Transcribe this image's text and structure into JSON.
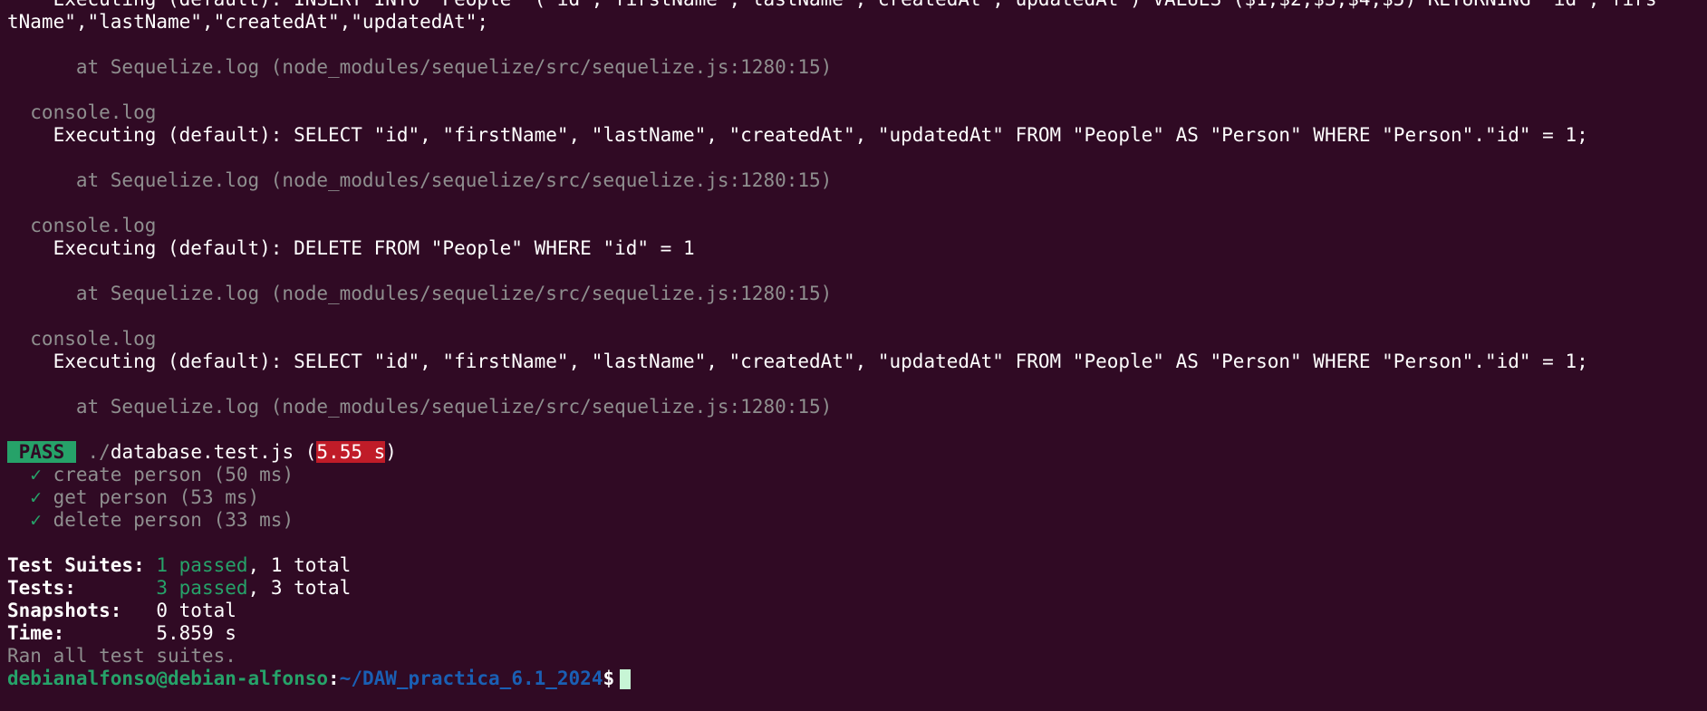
{
  "terminal": {
    "insert_line_1": "    Executing (default): INSERT INTO \"People\" (\"id\",\"firstName\",\"lastName\",\"createdAt\",\"updatedAt\") VALUES ($1,$2,$3,$4,$5) RETURNING \"id\",\"firs",
    "insert_line_2": "tName\",\"lastName\",\"createdAt\",\"updatedAt\";",
    "trace_1": "      at Sequelize.log (node_modules/sequelize/src/sequelize.js:1280:15)",
    "console_label_1": "  console.log",
    "select_line_1": "    Executing (default): SELECT \"id\", \"firstName\", \"lastName\", \"createdAt\", \"updatedAt\" FROM \"People\" AS \"Person\" WHERE \"Person\".\"id\" = 1;",
    "trace_2": "      at Sequelize.log (node_modules/sequelize/src/sequelize.js:1280:15)",
    "console_label_2": "  console.log",
    "delete_line": "    Executing (default): DELETE FROM \"People\" WHERE \"id\" = 1",
    "trace_3": "      at Sequelize.log (node_modules/sequelize/src/sequelize.js:1280:15)",
    "console_label_3": "  console.log",
    "select_line_2": "    Executing (default): SELECT \"id\", \"firstName\", \"lastName\", \"createdAt\", \"updatedAt\" FROM \"People\" AS \"Person\" WHERE \"Person\".\"id\" = 1;",
    "trace_4": "      at Sequelize.log (node_modules/sequelize/src/sequelize.js:1280:15)"
  },
  "result": {
    "pass_badge": " PASS ",
    "path_prefix": "./",
    "file_name": "database.test.js",
    "duration": "5.55 s",
    "tests": [
      {
        "check": "  ✓ ",
        "name": "create person (50 ms)"
      },
      {
        "check": "  ✓ ",
        "name": "get person (53 ms)"
      },
      {
        "check": "  ✓ ",
        "name": "delete person (33 ms)"
      }
    ]
  },
  "summary": {
    "suites_label": "Test Suites: ",
    "suites_passed": "1 passed",
    "suites_total": ", 1 total",
    "tests_label": "Tests:       ",
    "tests_passed": "3 passed",
    "tests_total": ", 3 total",
    "snapshots_label": "Snapshots:   ",
    "snapshots_value": "0 total",
    "time_label": "Time:        ",
    "time_value": "5.859 s",
    "ran_all": "Ran all test suites."
  },
  "prompt": {
    "user_host": "debianalfonso@debian-alfonso",
    "colon": ":",
    "path": "~/DAW_practica_6.1_2024",
    "dollar": "$"
  },
  "colors": {
    "background": "#300a24",
    "pass_green": "#26a269",
    "fail_red": "#c01c28",
    "path_blue": "#1a5fb4",
    "dim_gray": "#8f8f8f"
  }
}
